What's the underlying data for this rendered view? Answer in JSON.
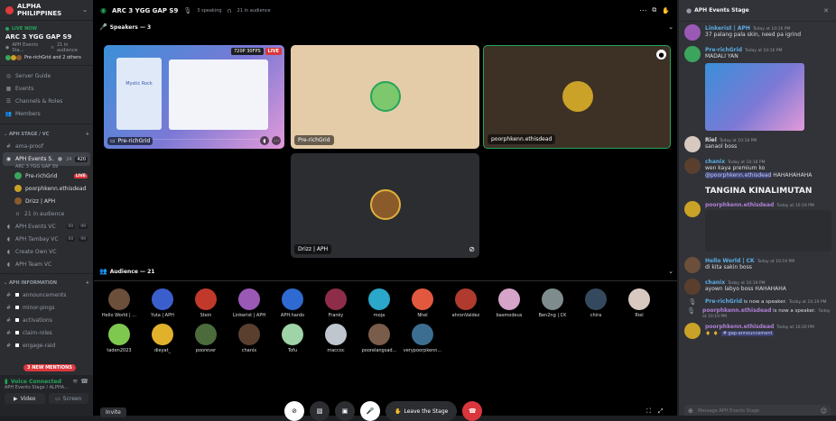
{
  "server": {
    "name": "ALPHA PHILIPPINES",
    "chevron": "⌄"
  },
  "live": {
    "badge": "LIVE NOW",
    "title": "ARC 3 YGG GAP S9",
    "stage": "APH Events Sta...",
    "audience": "21 in audience",
    "speakers": "Pre-richGrid and 2 others"
  },
  "nav": [
    {
      "label": "Server Guide",
      "icon": "compass-icon",
      "glyph": "◎"
    },
    {
      "label": "Events",
      "icon": "calendar-icon",
      "glyph": "▦"
    },
    {
      "label": "Channels & Roles",
      "icon": "channels-icon",
      "glyph": "☰"
    },
    {
      "label": "Members",
      "icon": "members-icon",
      "glyph": "👥"
    }
  ],
  "cat_stage": "APH STAGE / VC",
  "ama_proof": "ama-proof",
  "active_channel": {
    "label": "APH Events S...",
    "listeners": "24",
    "count": "420",
    "subtitle": "ARC 3 YGG GAP S9"
  },
  "stage_members": [
    {
      "name": "Pre-richGrid",
      "live": "LIVE",
      "color": "#3ba55d"
    },
    {
      "name": "poorphkenn.ethisdead",
      "live": "",
      "color": "#c9a227"
    },
    {
      "name": "Drizz | APH",
      "live": "",
      "color": "#8b5a2b"
    }
  ],
  "stage_audience": "21 in audience",
  "voice_channels": [
    {
      "label": "APH Events VC",
      "a": "00",
      "b": "99"
    },
    {
      "label": "APH Tambay VC",
      "a": "00",
      "b": "99"
    },
    {
      "label": "Create Own VC",
      "a": "",
      "b": ""
    },
    {
      "label": "APH Team VC",
      "a": "",
      "b": ""
    }
  ],
  "cat_info": "APH INFORMATION",
  "info_channels": [
    "announcements",
    "minor-pings",
    "activations",
    "claim-roles",
    "engage-raid"
  ],
  "mentions_badge": "3 NEW MENTIONS",
  "voice_status": {
    "title": "Voice Connected",
    "sub": "APH Events Stage / ALPHA..."
  },
  "video_btn": "Video",
  "screen_btn": "Screen",
  "topbar": {
    "title": "ARC 3 YGG GAP S9",
    "speaking": "3 speaking",
    "audience": "21 in audience"
  },
  "speakers_header": "Speakers — 3",
  "tiles": [
    {
      "name": "Pre-richGrid",
      "badge_fps": "720P 30FPS",
      "badge_live": "LIVE"
    },
    {
      "name": "Pre-richGrid"
    },
    {
      "name": "poorphkenn.ethisdead"
    },
    {
      "name": "Drizz | APH"
    }
  ],
  "screen_share": {
    "title": "Mystic Rock"
  },
  "audience_header": "Audience — 21",
  "audience": [
    {
      "name": "Hello World | ...",
      "color": "#6b4f3a"
    },
    {
      "name": "Yuta | APH",
      "color": "#3a5fcd"
    },
    {
      "name": "Stein",
      "color": "#c0392b"
    },
    {
      "name": "Linkerist | APH",
      "color": "#9b59b6"
    },
    {
      "name": "APH.hardo",
      "color": "#2e6ad1"
    },
    {
      "name": "Franky",
      "color": "#8e2d4a"
    },
    {
      "name": "moja",
      "color": "#2aa7c9"
    },
    {
      "name": "Nhel",
      "color": "#e2583e"
    },
    {
      "name": "ahronValdez",
      "color": "#b03a2e"
    },
    {
      "name": "basmodeus",
      "color": "#d6a3c9"
    },
    {
      "name": "Ben2ng | CK",
      "color": "#7f8c8d"
    },
    {
      "name": "chira",
      "color": "#34495e"
    },
    {
      "name": "Riel",
      "color": "#d7c9c0"
    },
    {
      "name": "taden2023",
      "color": "#7ec850"
    },
    {
      "name": "dieyat_",
      "color": "#e1b12c"
    },
    {
      "name": "poorever",
      "color": "#4b6b3c"
    },
    {
      "name": "chanix",
      "color": "#5a3f2f"
    },
    {
      "name": "Tofu",
      "color": "#9fd3a8"
    },
    {
      "name": "maccoc",
      "color": "#bfc6ce"
    },
    {
      "name": "poorelangsad...",
      "color": "#7a5c4a"
    },
    {
      "name": "verypoorpkenn...",
      "color": "#3c6e91"
    }
  ],
  "bottom": {
    "invite": "Invite",
    "leave": "Leave the Stage"
  },
  "chat_header": "APH Events Stage",
  "messages": [
    {
      "user": "Linkerist | APH",
      "color": "#5dade2",
      "time": "Today at 10:16 PM",
      "text": "37 palang pala skin, need pa igrind",
      "av": "#9b59b6"
    },
    {
      "user": "Pre-richGrid",
      "color": "#5dade2",
      "time": "Today at 10:16 PM",
      "text": "MADALI YAN",
      "av": "#3ba55d"
    },
    {
      "user": "Riel",
      "color": "#dbdee1",
      "time": "Today at 10:18 PM",
      "text": "sanaol boss",
      "av": "#d7c9c0"
    },
    {
      "user": "chanix",
      "color": "#5dade2",
      "time": "Today at 10:18 PM",
      "text": "wen kaya premium ko ",
      "mention": "@poorphkenn.ethisdead",
      "text2": " HAHAHAHAHA",
      "big": "TANGINA KINALIMUTAN",
      "av": "#5a3f2f"
    },
    {
      "user": "poorphkenn.ethisdead",
      "color": "#b180d7",
      "time": "Today at 10:19 PM",
      "text": "",
      "av": "#c9a227"
    },
    {
      "user": "Hello World | CK",
      "color": "#5dade2",
      "time": "Today at 10:19 PM",
      "text": "di kita sakin boss",
      "av": "#6b4f3a"
    },
    {
      "user": "chanix",
      "color": "#5dade2",
      "time": "Today at 10:19 PM",
      "text": "ayown labyo boss HAHAHAHA",
      "av": "#5a3f2f"
    },
    {
      "user": "poorphkenn.ethisdead",
      "color": "#b180d7",
      "time": "Today at 10:20 PM",
      "text": "",
      "channel": "# gap-announcement",
      "av": "#c9a227"
    }
  ],
  "system_events": [
    {
      "user": "Pre-richGrid",
      "text": "is now a speaker.",
      "time": "Today at 10:19 PM",
      "color": "#5dade2"
    },
    {
      "user": "poorphkenn.ethisdead",
      "text": "is now a speaker.",
      "time": "Today at 10:19 PM",
      "color": "#b180d7"
    }
  ],
  "chat_input_placeholder": "Message APH Events Stage"
}
